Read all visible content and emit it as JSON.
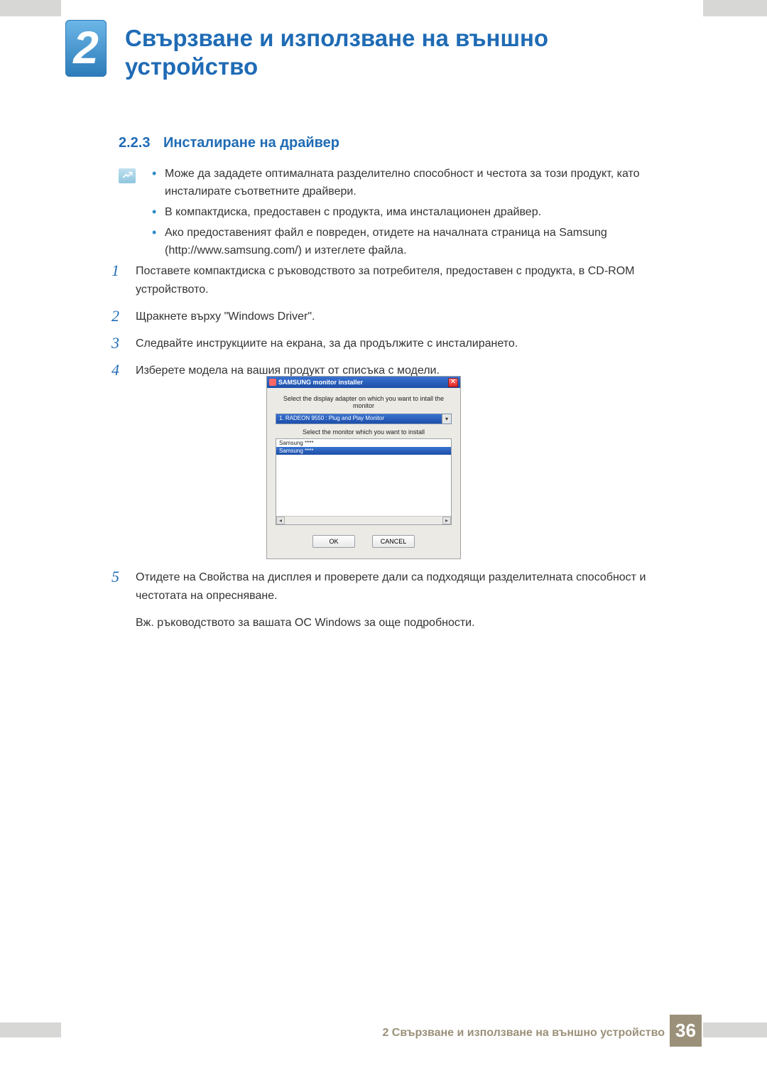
{
  "chapter": {
    "number": "2",
    "title": "Свързване и използване на външно устройство"
  },
  "section": {
    "number": "2.2.3",
    "title": "Инсталиране на драйвер"
  },
  "notes": [
    "Може да зададете оптималната разделително способност и честота за този продукт, като инсталирате съответните драйвери.",
    "В компактдиска, предоставен с продукта, има инсталационен драйвер.",
    "Ако предоставеният файл е повреден, отидете на началната страница на Samsung (http://www.samsung.com/) и изтеглете файла."
  ],
  "steps_top": [
    {
      "num": "1",
      "text": "Поставете компактдиска с ръководството за потребителя, предоставен с продукта, в CD-ROM устройството."
    },
    {
      "num": "2",
      "text": "Щракнете върху \"Windows Driver\"."
    },
    {
      "num": "3",
      "text": "Следвайте инструкциите на екрана, за да продължите с инсталирането."
    },
    {
      "num": "4",
      "text": "Изберете модела на вашия продукт от списъка с модели."
    }
  ],
  "installer": {
    "title": "SAMSUNG monitor installer",
    "label1": "Select the display adapter on which you want to intall the monitor",
    "adapter": "1. RADEON 9550 : Plug and Play Monitor",
    "label2": "Select the monitor which you want to install",
    "rows": [
      "Samsung ****",
      "Samsung ****"
    ],
    "ok": "OK",
    "cancel": "CANCEL"
  },
  "steps_bottom": [
    {
      "num": "5",
      "text": "Отидете на Свойства на дисплея и проверете дали са подходящи разделителната способност и честотата на опресняване."
    }
  ],
  "extra": "Вж. ръководството за вашата ОС Windows за още подробности.",
  "footer": {
    "text": "2 Свързване и използване на външно устройство",
    "page": "36"
  }
}
